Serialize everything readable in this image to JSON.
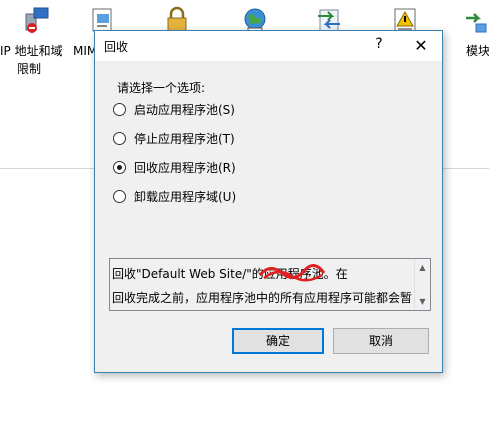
{
  "background": {
    "icons": [
      {
        "name": "ip-domain-restrictions",
        "label_line1": "IP 地址和域",
        "label_line2": "限制"
      },
      {
        "name": "mime-types",
        "label_line1": "MIM",
        "label_line2": ""
      },
      {
        "name": "authorization",
        "label_line1": "",
        "label_line2": ""
      },
      {
        "name": "default-document",
        "label_line1": "",
        "label_line2": ""
      },
      {
        "name": "handler-mappings",
        "label_line1": "",
        "label_line2": ""
      },
      {
        "name": "error-pages",
        "label_line1": "",
        "label_line2": ""
      },
      {
        "name": "modules",
        "label_line1": "模块",
        "label_line2": ""
      }
    ]
  },
  "dialog": {
    "title": "回收",
    "help": "?",
    "close": "✕",
    "prompt": "请选择一个选项:",
    "options": [
      {
        "label": "启动应用程序池(S)",
        "checked": false
      },
      {
        "label": "停止应用程序池(T)",
        "checked": false
      },
      {
        "label": "回收应用程序池(R)",
        "checked": true
      },
      {
        "label": "卸载应用程序域(U)",
        "checked": false
      }
    ],
    "description_line1": "回收\"Default Web Site/\"的应用程序池。在",
    "description_line2": "回收完成之前，应用程序池中的所有应用程序可能都会暂",
    "ok_label": "确定",
    "cancel_label": "取消"
  },
  "colors": {
    "accent": "#0078d7",
    "dialog_border": "#3c7fb1",
    "dialog_bg": "#f0f0f0",
    "redaction": "#e02020"
  }
}
